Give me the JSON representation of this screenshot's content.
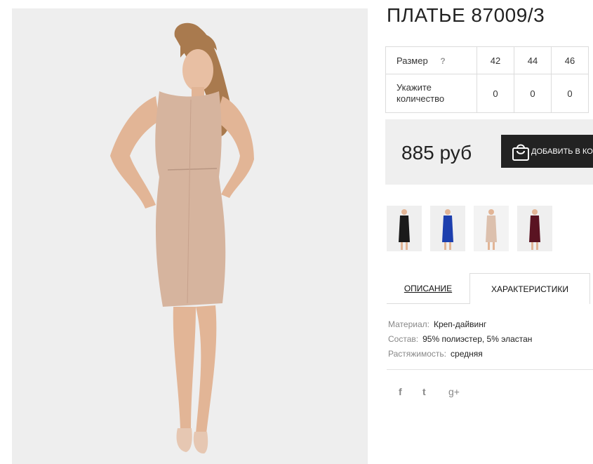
{
  "product": {
    "title": "ПЛАТЬЕ 87009/3",
    "image_alt": "dress-photo"
  },
  "sizes": {
    "size_label": "Размер",
    "help": "?",
    "qty_label": "Укажите количество",
    "values": [
      "42",
      "44",
      "46"
    ],
    "quantities": [
      "0",
      "0",
      "0"
    ]
  },
  "price": {
    "amount": "885 руб",
    "button_label": "ДОБАВИТЬ В КОРЗИНУ"
  },
  "thumbnails": [
    {
      "color": "#1a1a1a",
      "name": "black"
    },
    {
      "color": "#1d3fae",
      "name": "blue"
    },
    {
      "color": "#dcc0ad",
      "name": "beige"
    },
    {
      "color": "#5a1322",
      "name": "burgundy"
    }
  ],
  "tabs": {
    "description": "ОПИСАНИЕ",
    "characteristics": "ХАРАКТЕРИСТИКИ"
  },
  "specs": [
    {
      "key": "Материал:",
      "value": "Креп-дайвинг"
    },
    {
      "key": "Состав:",
      "value": "95% полиэстер, 5% эластан"
    },
    {
      "key": "Растяжимость:",
      "value": "средняя"
    }
  ],
  "social": {
    "facebook": "f",
    "twitter": "t",
    "google": "g+"
  },
  "colors": {
    "panel": "#efefef",
    "button": "#222222",
    "dress": "#d6b49e"
  }
}
